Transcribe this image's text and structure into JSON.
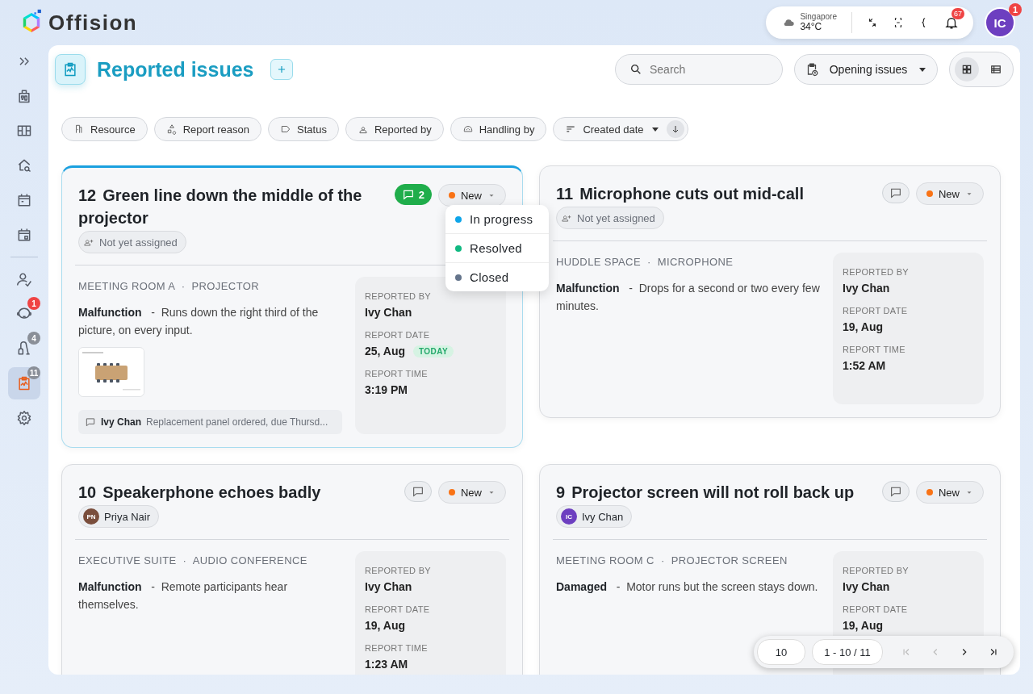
{
  "header": {
    "logo": "Offision",
    "weather": {
      "city": "Singapore",
      "temp": "34°C"
    },
    "notifications": "67",
    "avatar": {
      "initials": "IC",
      "badge": "1"
    }
  },
  "sidebar": {
    "items": [
      {
        "kind": "expand",
        "selected": false
      },
      {
        "kind": "building",
        "selected": false
      },
      {
        "kind": "board",
        "selected": false
      },
      {
        "kind": "house-search",
        "selected": false
      },
      {
        "kind": "calendar",
        "selected": false
      },
      {
        "kind": "calendar-day",
        "selected": false
      },
      {
        "kind": "divider"
      },
      {
        "kind": "user-check",
        "selected": false
      },
      {
        "kind": "face",
        "selected": false,
        "badge": "1",
        "color": "#ef4444"
      },
      {
        "kind": "cleaning",
        "selected": false,
        "badge": "4",
        "color": "#8a8f98"
      },
      {
        "kind": "report",
        "selected": true,
        "badge": "11",
        "color": "#8a8f98"
      },
      {
        "kind": "settings",
        "selected": false
      }
    ]
  },
  "page": {
    "title": "Reported issues",
    "search": {
      "placeholder": "Search"
    },
    "view_filter": "Opening issues",
    "view_modes": [
      {
        "kind": "grid",
        "selected": true
      },
      {
        "kind": "list",
        "selected": false
      }
    ]
  },
  "filters": [
    {
      "kind": "resource",
      "label": "Resource"
    },
    {
      "kind": "reason",
      "label": "Report reason"
    },
    {
      "kind": "status",
      "label": "Status"
    },
    {
      "kind": "person",
      "label": "Reported by"
    },
    {
      "kind": "handler",
      "label": "Handling by"
    }
  ],
  "sort": {
    "label": "Created date"
  },
  "issues": [
    {
      "number": "12",
      "title": "Green line down the middle of the projector",
      "selected": true,
      "comments": "2",
      "status": "New",
      "assignee": {
        "kind": "unassigned",
        "name": "Not yet assigned"
      },
      "place": "MEETING ROOM A  ·  PROJECTOR",
      "description": "**Malfunction**   -  Runs down the right third of the picture, on every input.",
      "attachment": {
        "kind": "picture"
      },
      "note": {
        "author": "Ivy Chan",
        "text": "Replacement panel ordered, due Thursd..."
      },
      "info": [
        {
          "label": "REPORTED BY",
          "value": "Ivy Chan"
        },
        {
          "label": "REPORT DATE",
          "value": "25, Aug",
          "badge": "TODAY"
        },
        {
          "label": "REPORT TIME",
          "value": "3:19 PM"
        }
      ],
      "status_menu": [
        {
          "label": "In progress",
          "color": "#0ea5e9"
        },
        {
          "label": "Resolved",
          "color": "#10b981"
        },
        {
          "label": "Closed",
          "color": "#64748b"
        }
      ]
    },
    {
      "number": "11",
      "title": "Microphone cuts out mid-call",
      "selected": false,
      "status": "New",
      "assignee": {
        "kind": "unassigned",
        "name": "Not yet assigned"
      },
      "place": "HUDDLE SPACE  ·  MICROPHONE",
      "description": "**Malfunction**   -  Drops for a second or two every few minutes.",
      "info": [
        {
          "label": "REPORTED BY",
          "value": "Ivy Chan"
        },
        {
          "label": "REPORT DATE",
          "value": "19, Aug"
        },
        {
          "label": "REPORT TIME",
          "value": "1:52 AM"
        }
      ]
    },
    {
      "number": "10",
      "title": "Speakerphone echoes badly",
      "selected": false,
      "status": "New",
      "assignee": {
        "kind": "person",
        "initials": "PN",
        "name": "Priya Nair",
        "color": "#7a4e3c"
      },
      "place": "EXECUTIVE SUITE  ·  AUDIO CONFERENCE",
      "description": "**Malfunction**   -  Remote participants hear themselves.",
      "info": [
        {
          "label": "REPORTED BY",
          "value": "Ivy Chan"
        },
        {
          "label": "REPORT DATE",
          "value": "19, Aug"
        },
        {
          "label": "REPORT TIME",
          "value": "1:23 AM"
        }
      ]
    },
    {
      "number": "9",
      "title": "Projector screen will not roll back up",
      "selected": false,
      "status": "New",
      "assignee": {
        "kind": "person",
        "initials": "IC",
        "name": "Ivy Chan",
        "color": "#6d3fc0"
      },
      "place": "MEETING ROOM C  ·  PROJECTOR SCREEN",
      "description": "**Damaged**   -  Motor runs but the screen stays down.",
      "info": [
        {
          "label": "REPORTED BY",
          "value": "Ivy Chan"
        },
        {
          "label": "REPORT DATE",
          "value": "19, Aug"
        }
      ]
    }
  ],
  "pagination": {
    "page_size": "10",
    "range": "1 - 10 / 11"
  }
}
